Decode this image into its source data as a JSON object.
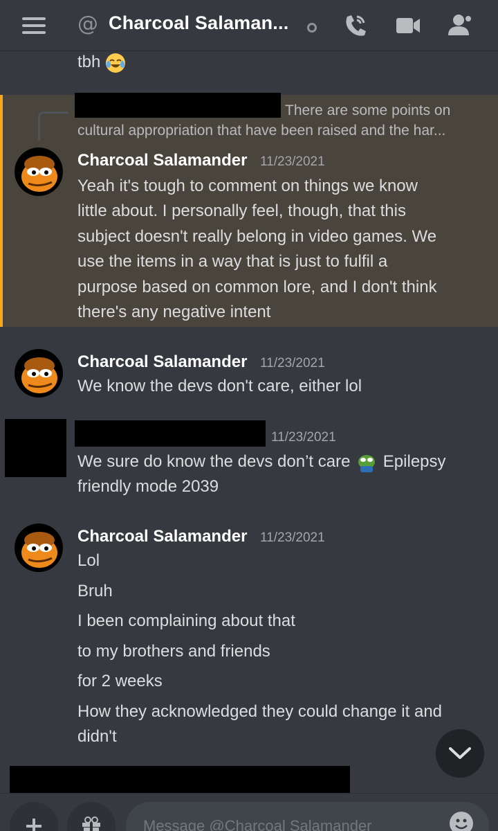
{
  "header": {
    "title": "Charcoal Salaman...",
    "at_symbol": "@",
    "icons": [
      "menu-icon",
      "at-icon",
      "status-offline-icon",
      "call-icon",
      "video-icon",
      "members-icon"
    ]
  },
  "messages": {
    "prev_line": "tbh",
    "reply": {
      "preview_line1": "There are some points on",
      "preview_line2": "cultural appropriation that have been raised and the har..."
    },
    "msg1": {
      "author": "Charcoal Salamander",
      "timestamp": "11/23/2021",
      "lines": [
        "Yeah it's tough to comment on things we know",
        "little about. I personally feel, though, that this",
        "subject doesn't really belong in video games. We",
        "use the items in a way that is just to fulfil a",
        "purpose based on common lore, and I don't think",
        "there's any negative intent"
      ]
    },
    "msg2": {
      "author": "Charcoal Salamander",
      "timestamp": "11/23/2021",
      "lines": [
        "We know the devs don't care, either lol"
      ]
    },
    "msg3": {
      "timestamp": "11/23/2021",
      "line1_a": "We sure do know the devs don’t care",
      "line1_b": "Epilepsy",
      "line2": "friendly mode 2039"
    },
    "msg4": {
      "author": "Charcoal Salamander",
      "timestamp": "11/23/2021",
      "lines": [
        "Lol",
        "Bruh",
        "I been complaining about that",
        "to my brothers and friends",
        "for 2 weeks",
        "How they acknowledged they could change it and",
        "didn't"
      ]
    }
  },
  "composer": {
    "placeholder": "Message @Charcoal Salamander"
  },
  "colors": {
    "background": "#36393f",
    "highlight": "#49443c",
    "highlight_border": "#faa61a",
    "username": "#ffffff",
    "timestamp": "#a3a6aa"
  }
}
